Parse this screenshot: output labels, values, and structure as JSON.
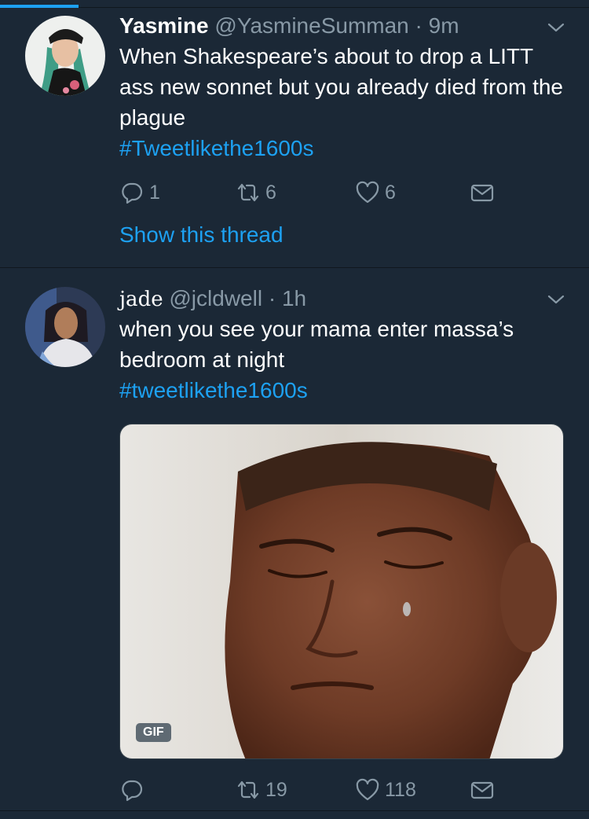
{
  "tweets": [
    {
      "name": "Yasmine",
      "handle": "@YasmineSumman",
      "separator": "·",
      "time": "9m",
      "text": "When Shakespeare’s about to drop a LITT ass new sonnet but you already died from the plague",
      "hashtag": "#Tweetlikethe1600s",
      "replies": "1",
      "retweets": "6",
      "likes": "6",
      "show_thread": "Show this thread"
    },
    {
      "name": "jade",
      "handle": "@jcldwell",
      "separator": "·",
      "time": "1h",
      "text": "when you see your mama enter massa’s bedroom at night",
      "hashtag": "#tweetlikethe1600s",
      "media_badge": "GIF",
      "replies": "",
      "retweets": "19",
      "likes": "118"
    }
  ],
  "icons": {
    "reply": "reply-icon",
    "retweet": "retweet-icon",
    "like": "heart-icon",
    "dm": "envelope-icon",
    "more": "chevron-down-icon"
  },
  "colors": {
    "background": "#1b2836",
    "accent": "#1da1f2",
    "secondary_text": "#8899a6",
    "divider": "#10171e"
  }
}
